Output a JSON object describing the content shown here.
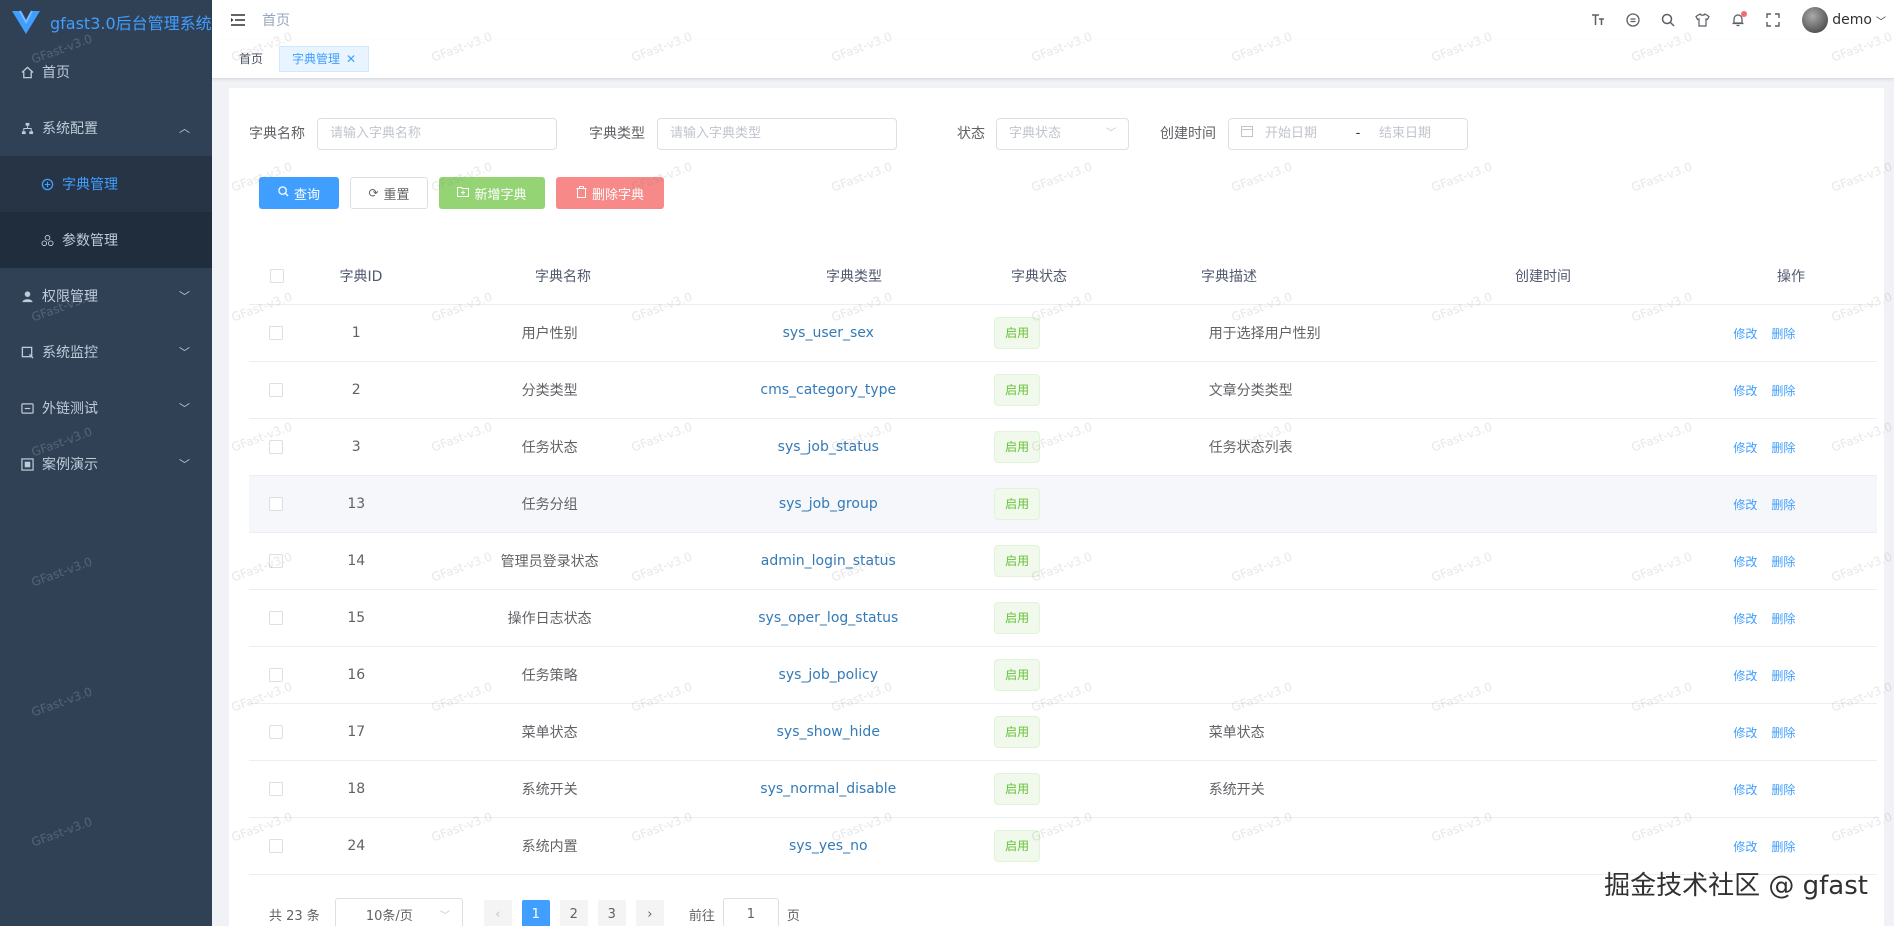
{
  "app": {
    "title": "gfast3.0后台管理系统"
  },
  "sidebar": {
    "home": "首页",
    "groups": [
      {
        "label": "系统配置",
        "expanded": true,
        "children": [
          {
            "label": "字典管理",
            "active": true
          },
          {
            "label": "参数管理",
            "active": false
          }
        ]
      },
      {
        "label": "权限管理",
        "expanded": false
      },
      {
        "label": "系统监控",
        "expanded": false
      },
      {
        "label": "外链测试",
        "expanded": false
      },
      {
        "label": "案例演示",
        "expanded": false
      }
    ]
  },
  "header": {
    "breadcrumb": "首页",
    "user": "demo",
    "icons": [
      "font-size-icon",
      "github-icon",
      "search-icon",
      "theme-icon",
      "bell-icon",
      "fullscreen-icon"
    ]
  },
  "tags": [
    {
      "label": "首页",
      "active": false
    },
    {
      "label": "字典管理",
      "active": true
    }
  ],
  "search": {
    "dict_name_label": "字典名称",
    "dict_name_placeholder": "请输入字典名称",
    "dict_type_label": "字典类型",
    "dict_type_placeholder": "请输入字典类型",
    "status_label": "状态",
    "status_placeholder": "字典状态",
    "created_label": "创建时间",
    "start_placeholder": "开始日期",
    "range_sep": "-",
    "end_placeholder": "结束日期"
  },
  "buttons": {
    "query": "查询",
    "reset": "重置",
    "add": "新增字典",
    "delete": "删除字典"
  },
  "table": {
    "headers": [
      "字典ID",
      "字典名称",
      "字典类型",
      "字典状态",
      "字典描述",
      "创建时间",
      "操作"
    ],
    "edit_label": "修改",
    "remove_label": "删除",
    "rows": [
      {
        "id": "1",
        "name": "用户性别",
        "type": "sys_user_sex",
        "status": "启用",
        "desc": "用于选择用户性别"
      },
      {
        "id": "2",
        "name": "分类类型",
        "type": "cms_category_type",
        "status": "启用",
        "desc": "文章分类类型"
      },
      {
        "id": "3",
        "name": "任务状态",
        "type": "sys_job_status",
        "status": "启用",
        "desc": "任务状态列表"
      },
      {
        "id": "13",
        "name": "任务分组",
        "type": "sys_job_group",
        "status": "启用",
        "desc": ""
      },
      {
        "id": "14",
        "name": "管理员登录状态",
        "type": "admin_login_status",
        "status": "启用",
        "desc": ""
      },
      {
        "id": "15",
        "name": "操作日志状态",
        "type": "sys_oper_log_status",
        "status": "启用",
        "desc": ""
      },
      {
        "id": "16",
        "name": "任务策略",
        "type": "sys_job_policy",
        "status": "启用",
        "desc": ""
      },
      {
        "id": "17",
        "name": "菜单状态",
        "type": "sys_show_hide",
        "status": "启用",
        "desc": "菜单状态"
      },
      {
        "id": "18",
        "name": "系统开关",
        "type": "sys_normal_disable",
        "status": "启用",
        "desc": "系统开关"
      },
      {
        "id": "24",
        "name": "系统内置",
        "type": "sys_yes_no",
        "status": "启用",
        "desc": ""
      }
    ]
  },
  "pagination": {
    "total": "共 23 条",
    "page_size": "10条/页",
    "pages": [
      "1",
      "2",
      "3"
    ],
    "current": "1",
    "goto_label": "前往",
    "goto_value": "1",
    "page_suffix": "页"
  },
  "watermark": "GFast-v3.0",
  "corner_text": "掘金技术社区 @ gfast"
}
